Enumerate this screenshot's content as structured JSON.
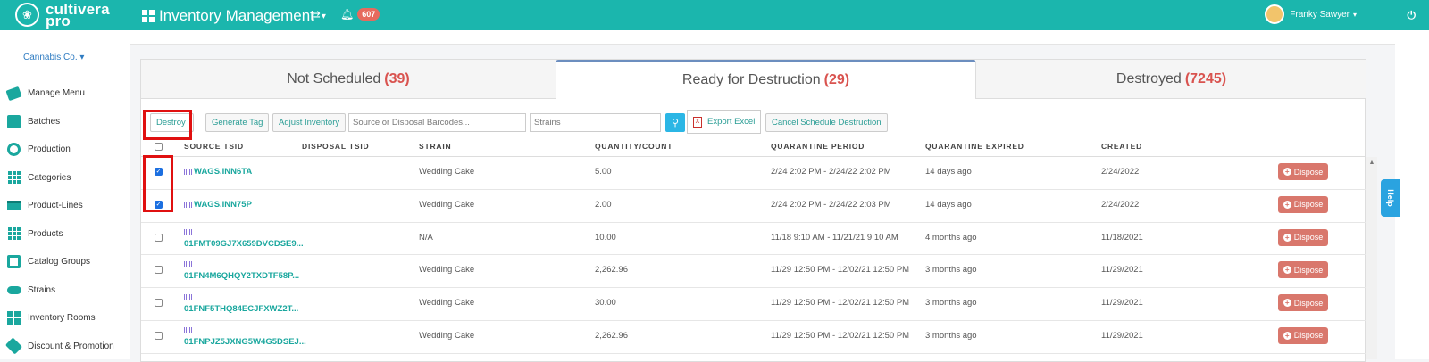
{
  "brand": {
    "logo_line1": "cultivera",
    "logo_line2": "pro"
  },
  "header": {
    "app_title": "Inventory Management",
    "notification_count": "607",
    "user_name": "Franky Sawyer"
  },
  "sidebar": {
    "company": "Cannabis Co.",
    "items": [
      {
        "label": "Manage Menu",
        "icon": "menu-tag-icon"
      },
      {
        "label": "Batches",
        "icon": "batches-icon"
      },
      {
        "label": "Production",
        "icon": "production-icon"
      },
      {
        "label": "Categories",
        "icon": "categories-icon"
      },
      {
        "label": "Product-Lines",
        "icon": "product-lines-icon"
      },
      {
        "label": "Products",
        "icon": "products-icon"
      },
      {
        "label": "Catalog Groups",
        "icon": "catalog-groups-icon"
      },
      {
        "label": "Strains",
        "icon": "strains-icon"
      },
      {
        "label": "Inventory Rooms",
        "icon": "inventory-rooms-icon"
      },
      {
        "label": "Discount & Promotion",
        "icon": "discount-icon"
      }
    ]
  },
  "tabs": [
    {
      "label": "Not Scheduled",
      "count": "(39)"
    },
    {
      "label": "Ready for Destruction",
      "count": "(29)"
    },
    {
      "label": "Destroyed",
      "count": "(7245)"
    }
  ],
  "toolbar": {
    "destroy": "Destroy",
    "generate_tag": "Generate Tag",
    "adjust_inventory": "Adjust Inventory",
    "barcode_placeholder": "Source or Disposal Barcodes...",
    "strains_placeholder": "Strains",
    "export_excel": "Export Excel",
    "cancel_schedule": "Cancel Schedule Destruction"
  },
  "table": {
    "columns": [
      "SOURCE TSID",
      "DISPOSAL TSID",
      "STRAIN",
      "QUANTITY/COUNT",
      "QUARANTINE PERIOD",
      "QUARANTINE EXPIRED",
      "CREATED"
    ],
    "dispose_label": "Dispose",
    "rows": [
      {
        "checked": true,
        "source": "WAGS.INN6TA",
        "strain": "Wedding Cake",
        "qty": "5.00",
        "period": "2/24 2:02 PM - 2/24/22 2:02 PM",
        "expired": "14 days ago",
        "created": "2/24/2022"
      },
      {
        "checked": true,
        "source": "WAGS.INN75P",
        "strain": "Wedding Cake",
        "qty": "2.00",
        "period": "2/24 2:02 PM - 2/24/22 2:03 PM",
        "expired": "14 days ago",
        "created": "2/24/2022"
      },
      {
        "checked": false,
        "source": "01FMT09GJ7X659DVCDSE9...",
        "strain": "N/A",
        "qty": "10.00",
        "period": "11/18 9:10 AM - 11/21/21 9:10 AM",
        "expired": "4 months ago",
        "created": "11/18/2021"
      },
      {
        "checked": false,
        "source": "01FN4M6QHQY2TXDTF58P...",
        "strain": "Wedding Cake",
        "qty": "2,262.96",
        "period": "11/29 12:50 PM - 12/02/21 12:50 PM",
        "expired": "3 months ago",
        "created": "11/29/2021"
      },
      {
        "checked": false,
        "source": "01FNF5THQ84ECJFXWZ2T...",
        "strain": "Wedding Cake",
        "qty": "30.00",
        "period": "11/29 12:50 PM - 12/02/21 12:50 PM",
        "expired": "3 months ago",
        "created": "11/29/2021"
      },
      {
        "checked": false,
        "source": "01FNPJZ5JXNG5W4G5DSEJ...",
        "strain": "Wedding Cake",
        "qty": "2,262.96",
        "period": "11/29 12:50 PM - 12/02/21 12:50 PM",
        "expired": "3 months ago",
        "created": "11/29/2021"
      }
    ]
  },
  "help_label": "Help",
  "colors": {
    "brand": "#1bb6ad",
    "count": "#d9534f",
    "dispose": "#d9776c",
    "highlight": "#e01010"
  }
}
